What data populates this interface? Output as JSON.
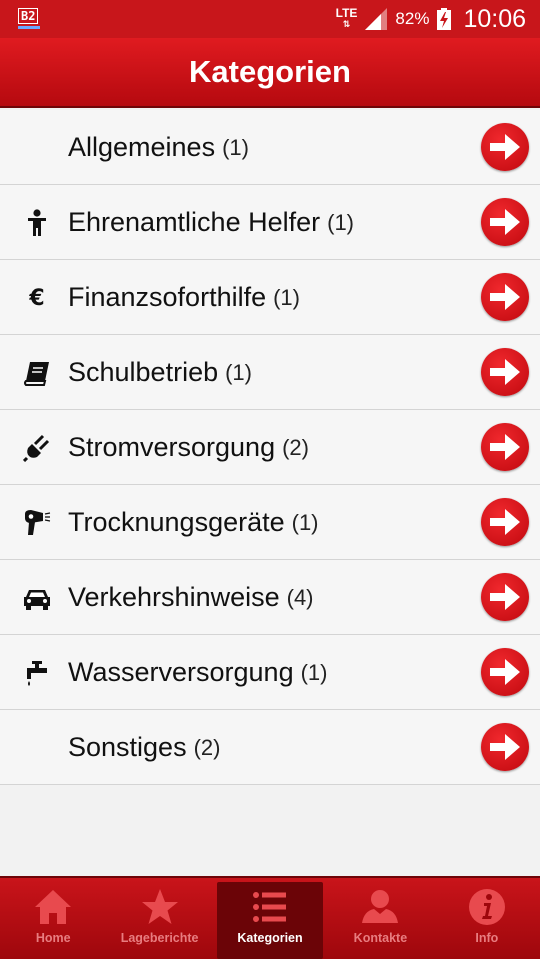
{
  "status_bar": {
    "carrier_badge": "B2",
    "network": "LTE",
    "battery": "82%",
    "time": "10:06"
  },
  "header": {
    "title": "Kategorien"
  },
  "categories": [
    {
      "label": "Allgemeines",
      "count": "(1)",
      "icon": "none"
    },
    {
      "label": "Ehrenamtliche Helfer",
      "count": "(1)",
      "icon": "person-icon"
    },
    {
      "label": "Finanzsoforthilfe",
      "count": "(1)",
      "icon": "euro-icon"
    },
    {
      "label": "Schulbetrieb",
      "count": "(1)",
      "icon": "book-icon"
    },
    {
      "label": "Stromversorgung",
      "count": "(2)",
      "icon": "plug-icon"
    },
    {
      "label": "Trocknungsgeräte",
      "count": "(1)",
      "icon": "hair-dryer-icon"
    },
    {
      "label": "Verkehrshinweise",
      "count": "(4)",
      "icon": "car-icon"
    },
    {
      "label": "Wasserversorgung",
      "count": "(1)",
      "icon": "faucet-icon"
    },
    {
      "label": "Sonstiges",
      "count": "(2)",
      "icon": "none"
    }
  ],
  "bottom_nav": {
    "items": [
      {
        "label": "Home",
        "icon": "home-icon"
      },
      {
        "label": "Lageberichte",
        "icon": "star-icon"
      },
      {
        "label": "Kategorien",
        "icon": "list-icon",
        "active": true
      },
      {
        "label": "Kontakte",
        "icon": "contact-icon"
      },
      {
        "label": "Info",
        "icon": "info-icon"
      }
    ]
  },
  "colors": {
    "primary": "#c8161b",
    "nav_active_bg": "#6b0407",
    "nav_inactive_label": "#e87d80"
  }
}
